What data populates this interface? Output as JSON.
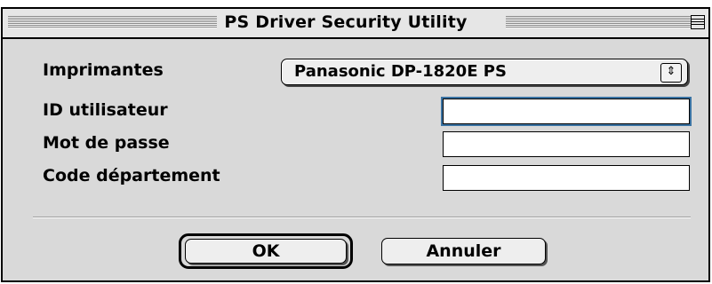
{
  "window": {
    "title": "PS Driver Security Utility"
  },
  "form": {
    "printer_label": "Imprimantes",
    "printer_value": "Panasonic DP-1820E PS",
    "user_id_label": "ID utilisateur",
    "user_id_value": "",
    "password_label": "Mot de passe",
    "password_value": "",
    "department_label": "Code département",
    "department_value": ""
  },
  "buttons": {
    "ok_label": "OK",
    "cancel_label": "Annuler"
  },
  "icons": {
    "popup_arrow": "up-down-arrows-icon",
    "collapse": "window-collapse-icon"
  }
}
